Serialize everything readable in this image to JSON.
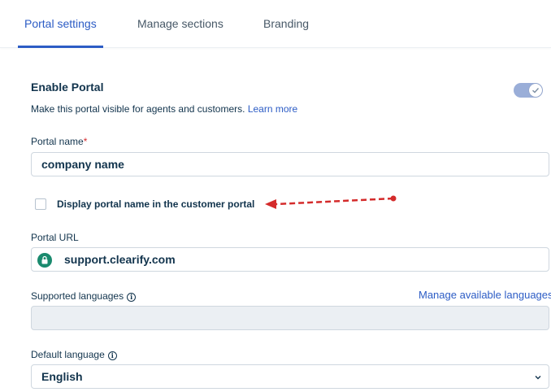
{
  "tabs": [
    {
      "label": "Portal settings",
      "active": true
    },
    {
      "label": "Manage sections",
      "active": false
    },
    {
      "label": "Branding",
      "active": false
    }
  ],
  "enable_portal": {
    "title": "Enable Portal",
    "description": "Make this portal visible for agents and customers.",
    "learn_more": "Learn more",
    "enabled": true
  },
  "portal_name": {
    "label": "Portal name",
    "required_mark": "*",
    "value": "company name"
  },
  "display_name_checkbox": {
    "label": "Display portal name in the customer portal",
    "checked": false
  },
  "portal_url": {
    "label": "Portal URL",
    "value": "support.clearify.com"
  },
  "supported_languages": {
    "label": "Supported languages",
    "manage_link": "Manage available languages",
    "value": ""
  },
  "default_language": {
    "label": "Default language",
    "value": "English"
  },
  "colors": {
    "accent": "#2c5cc5",
    "annotation_arrow": "#d42b2b",
    "lock_badge": "#1a8a6e"
  }
}
